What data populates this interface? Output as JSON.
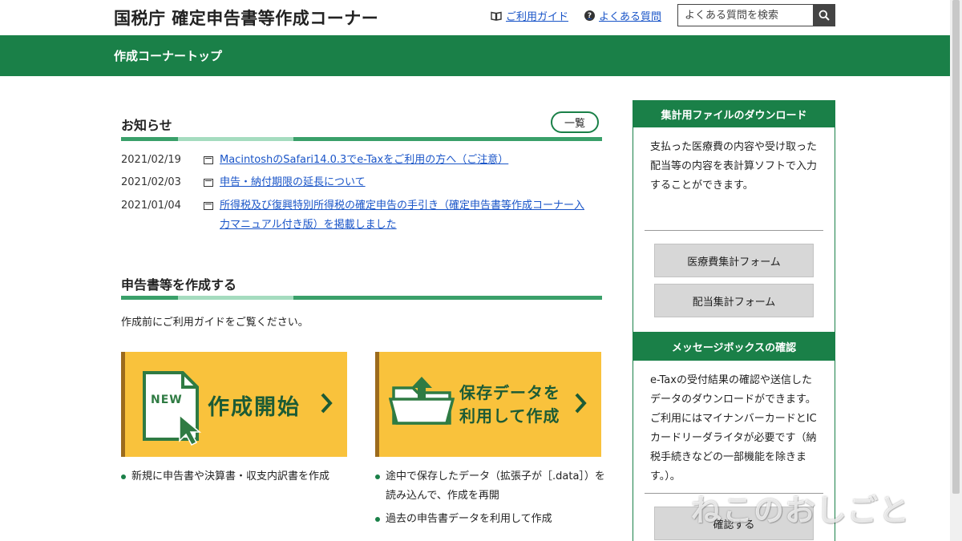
{
  "header": {
    "site_title": "国税庁 確定申告書等作成コーナー",
    "guide_link": "ご利用ガイド",
    "faq_link": "よくある質問",
    "search_placeholder": "よくある質問を検索"
  },
  "nav": {
    "title": "作成コーナートップ"
  },
  "news": {
    "title": "お知らせ",
    "list_button": "一覧",
    "items": [
      {
        "date": "2021/02/19",
        "text": "MacintoshのSafari14.0.3でe-Taxをご利用の方へ（ご注意）"
      },
      {
        "date": "2021/02/03",
        "text": "申告・納付期限の延長について"
      },
      {
        "date": "2021/01/04",
        "text": "所得税及び復興特別所得税の確定申告の手引き（確定申告書等作成コーナー入力マニュアル付き版）を掲載しました"
      }
    ]
  },
  "create": {
    "title": "申告書等を作成する",
    "intro": "作成前にご利用ガイドをご覧ください。",
    "start_button": "作成開始",
    "new_badge": "NEW",
    "saved_button_line1": "保存データを",
    "saved_button_line2": "利用して作成",
    "start_notes": [
      "新規に申告書や決算書・収支内訳書を作成"
    ],
    "saved_notes": [
      "途中で保存したデータ（拡張子が［.data］）を読み込んで、作成を再開",
      "過去の申告書データを利用して作成"
    ]
  },
  "sidebar": {
    "download": {
      "title": "集計用ファイルのダウンロード",
      "text": "支払った医療費の内容や受け取った配当等の内容を表計算ソフトで入力することができます。",
      "buttons": [
        "医療費集計フォーム",
        "配当集計フォーム"
      ]
    },
    "messagebox": {
      "title": "メッセージボックスの確認",
      "text": "e-Taxの受付結果の確認や送信したデータのダウンロードができます。ご利用にはマイナンバーカードとICカードリーダライタが必要です（納税手続きなどの一部機能を除きます。）。",
      "button": "確認する"
    }
  },
  "watermark": "ねこのおしごと",
  "colors": {
    "green": "#1a8048",
    "yellow": "#f9c23c",
    "link": "#1a55c8"
  }
}
